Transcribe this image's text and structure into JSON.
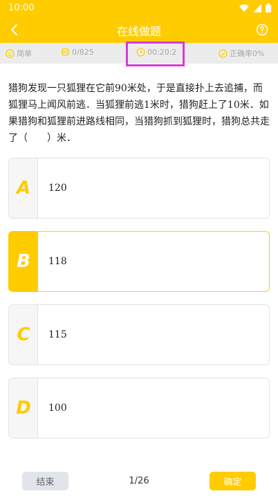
{
  "status_bar": {
    "time": "10:00"
  },
  "header": {
    "title": "在线做题"
  },
  "info_bar": {
    "difficulty": "简单",
    "progress_count": "0/825",
    "timer": "00:20:2",
    "accuracy": "正确率0%"
  },
  "question": {
    "text": "猎狗发现一只狐狸在它前90米处，于是直接扑上去追捕，而狐狸马上闻风前逃．当狐狸前逃1米时，猎狗赶上了10米．如果猎狗和狐狸前进路线相同，当猎狗抓到狐狸时，猎狗总共走了（　　）米．"
  },
  "options": [
    {
      "letter": "A",
      "text": "120"
    },
    {
      "letter": "B",
      "text": "118"
    },
    {
      "letter": "C",
      "text": "115"
    },
    {
      "letter": "D",
      "text": "100"
    }
  ],
  "footer": {
    "end_label": "结束",
    "page": "1/26",
    "confirm_label": "确定"
  },
  "colors": {
    "accent": "#ffcc00",
    "highlight_box": "#d63bd6"
  },
  "icons": [
    "back-arrow-icon",
    "help-icon",
    "smile-icon",
    "database-icon",
    "clock-icon",
    "check-circle-icon",
    "wifi-icon",
    "signal-icon",
    "battery-icon"
  ]
}
